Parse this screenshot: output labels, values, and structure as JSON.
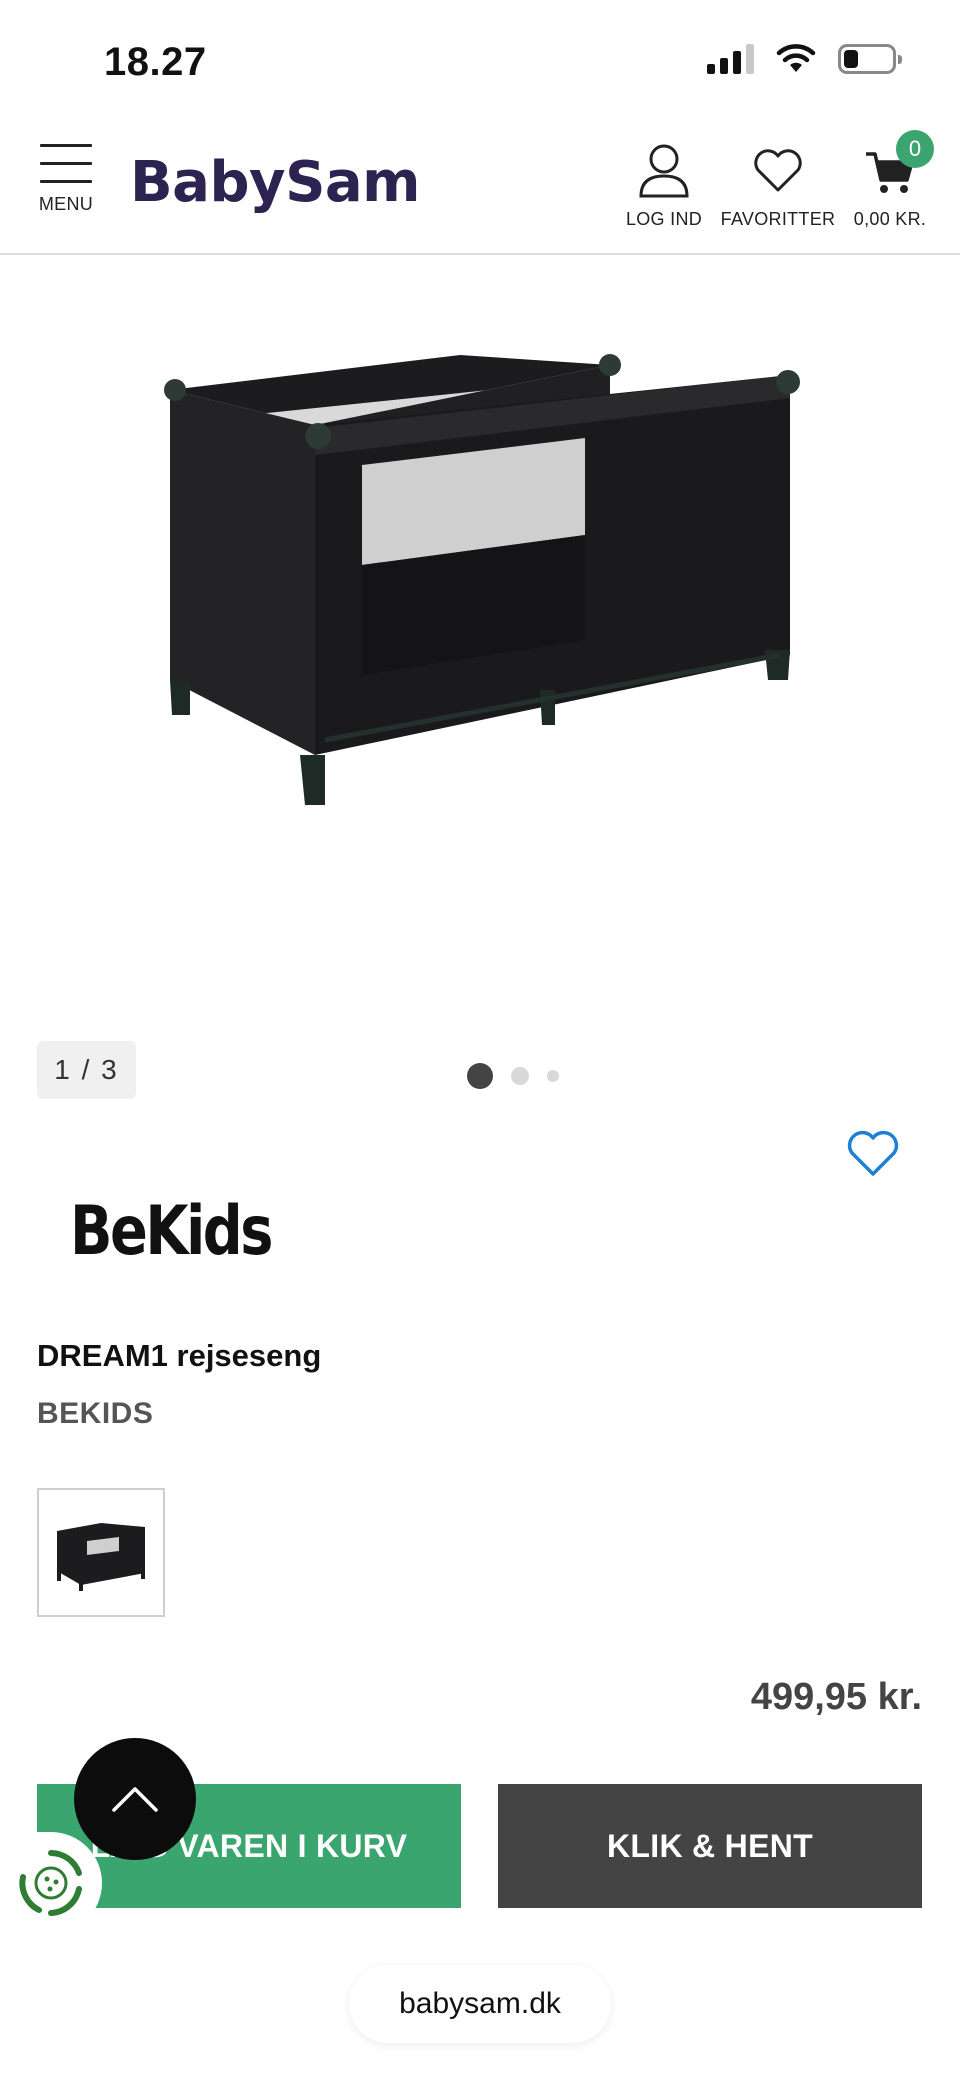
{
  "status": {
    "time": "18.27"
  },
  "header": {
    "menu_label": "MENU",
    "logo": "BabySam",
    "login_label": "LOG IND",
    "favorites_label": "FAVORITTER",
    "cart_label": "0,00 KR.",
    "cart_count": "0"
  },
  "gallery": {
    "counter": "1 / 3",
    "slides": 3,
    "active_slide": 1
  },
  "product": {
    "brand_logo": "BeKids",
    "title": "DREAM1 rejseseng",
    "brand": "BEKIDS",
    "price": "499,95 kr."
  },
  "actions": {
    "add_to_cart_label": "LÆG VAREN I KURV",
    "click_collect_label": "KLIK & HENT"
  },
  "browser": {
    "url": "babysam.dk"
  },
  "colors": {
    "brand": "#2c2350",
    "accent_green": "#3aa56f",
    "dark_button": "#444444",
    "heart_blue": "#1d7fd6"
  },
  "icons": [
    "menu-icon",
    "user-icon",
    "heart-icon",
    "cart-icon",
    "chevron-up-icon",
    "cookie-icon"
  ]
}
